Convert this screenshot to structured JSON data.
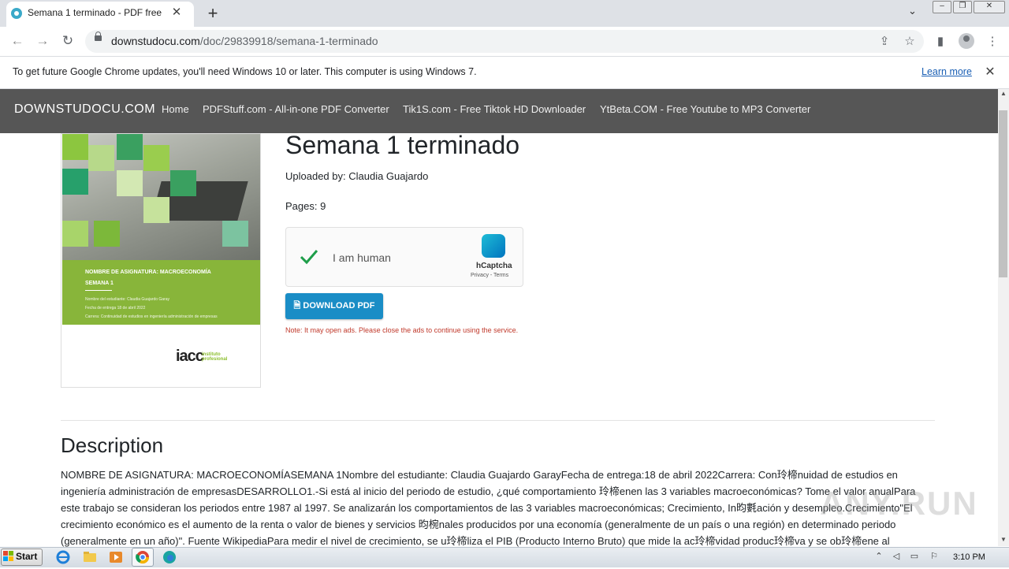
{
  "browser": {
    "tab_title": "Semana 1 terminado - PDF free",
    "url_domain": "downstudocu.com",
    "url_path": "/doc/29839918/semana-1-terminado",
    "infobar_text": "To get future Google Chrome updates, you'll need Windows 10 or later. This computer is using Windows 7.",
    "infobar_link": "Learn more"
  },
  "site": {
    "brand": "DOWNSTUDOCU.COM",
    "nav": [
      {
        "label": "Home"
      },
      {
        "label": "PDFStuff.com - All-in-one PDF Converter"
      },
      {
        "label": "Tik1S.com - Free Tiktok HD Downloader"
      },
      {
        "label": "YtBeta.COM - Free Youtube to MP3 Converter"
      }
    ]
  },
  "cover": {
    "subject": "NOMBRE DE ASIGNATURA: MACROECONOMÍA",
    "week": "SEMANA 1",
    "student": "Nombre del estudiante: Claudia Guajardo Garay",
    "date": "Fecha de entrega 18 de abril 2022",
    "career": "Carrera: Continuidad de estudios en ingeniería administración de empresas",
    "logo": "iacc",
    "logo_sub1": "instituto",
    "logo_sub2": "profesional"
  },
  "document": {
    "title": "Semana 1 terminado",
    "uploaded_by": "Uploaded by: Claudia Guajardo",
    "pages": "Pages: 9",
    "download_label": "DOWNLOAD PDF",
    "note": "Note: It may open ads. Please close the ads to continue using the service."
  },
  "captcha": {
    "label": "I am human",
    "brand": "hCaptcha",
    "links": "Privacy - Terms"
  },
  "description": {
    "heading": "Description",
    "body": "NOMBRE DE ASIGNATURA: MACROECONOMÍASEMANA 1Nombre del estudiante: Claudia Guajardo GarayFecha de entrega:18 de abril 2022Carrera: Con玲楴nuidad de estudios en ingeniería administración de empresasDESARROLLO1.-Si está al inicio del periodo de estudio, ¿qué comportamiento 玲楴enen las 3 variables macroeconómicas? Tome el valor anualPara este trabajo se consideran los periodos entre 1987 al 1997. Se analizarán los comportamientos de las 3 variables macroeconómicas; Crecimiento, In昀氀ación y desempleo.Crecimiento\"El crecimiento económico es el aumento de la renta o valor de bienes y servicios 昀椀nales producidos por una economía (generalmente de un país o una región) en determinado periodo (generalmente en un año)\". Fuente WikipediaPara medir el nivel de crecimiento, se u玲楴liza el PIB (Producto Interno Bruto) que mide la ac玲楴vidad produc玲楴va y se ob玲楴ene al"
  },
  "watermark": "ANY.RUN",
  "taskbar": {
    "start_label": "Start",
    "clock": "3:10 PM"
  },
  "colors": {
    "site_nav_bg": "#565656",
    "download_button": "#1a8dc6",
    "note_text": "#c0392b",
    "cover_green": "#88b53a"
  }
}
